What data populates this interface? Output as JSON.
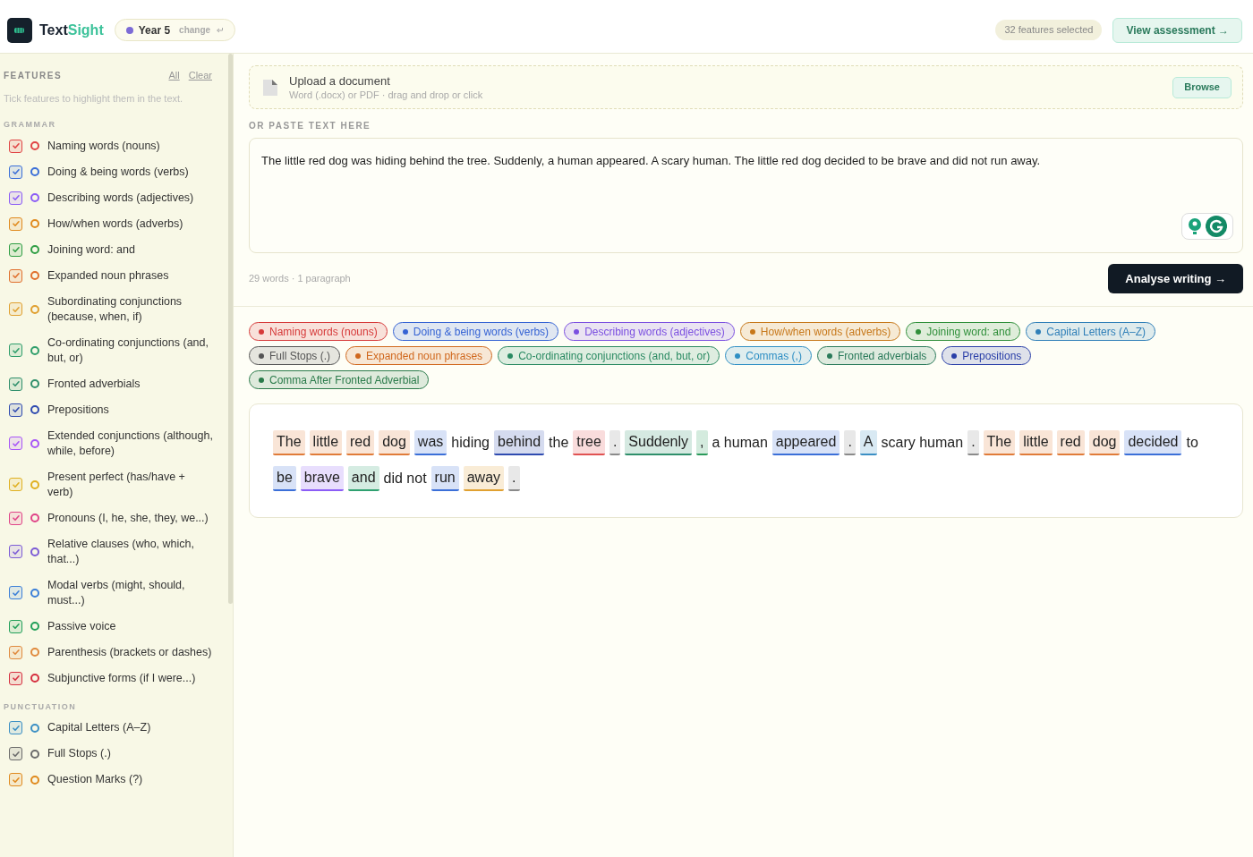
{
  "header": {
    "brand": {
      "first": "Text",
      "second": "Sight"
    },
    "year": {
      "label": "Year 5",
      "action": "change",
      "color": "#7c6bd6"
    },
    "count": "32 features selected",
    "view_button": "View assessment →"
  },
  "sidebar": {
    "title": "FEATURES",
    "all": "All",
    "clear": "Clear",
    "hint": "Tick features to highlight them in the text.",
    "groups": [
      {
        "title": "GRAMMAR",
        "items": [
          {
            "label": "Naming words (nouns)",
            "checked": true,
            "color": "#e04444"
          },
          {
            "label": "Doing & being words (verbs)",
            "checked": true,
            "color": "#3b6fd8"
          },
          {
            "label": "Describing words (adjectives)",
            "checked": true,
            "color": "#8b5cf6"
          },
          {
            "label": "How/when words (adverbs)",
            "checked": true,
            "color": "#e08a1e"
          },
          {
            "label": "Joining word: and",
            "checked": true,
            "color": "#2f9e44"
          },
          {
            "label": "Expanded noun phrases",
            "checked": true,
            "color": "#e0702e"
          },
          {
            "label": "Subordinating conjunctions (because, when, if)",
            "checked": true,
            "color": "#e0a030"
          },
          {
            "label": "Co-ordinating conjunctions (and, but, or)",
            "checked": true,
            "color": "#2f9e6b"
          },
          {
            "label": "Fronted adverbials",
            "checked": true,
            "color": "#2f8f6b"
          },
          {
            "label": "Prepositions",
            "checked": true,
            "color": "#2f4bb0"
          },
          {
            "label": "Extended conjunctions (although, while, before)",
            "checked": true,
            "color": "#a855f7"
          },
          {
            "label": "Present perfect (has/have + verb)",
            "checked": true,
            "color": "#e0b020"
          },
          {
            "label": "Pronouns (I, he, she, they, we...)",
            "checked": true,
            "color": "#e04488"
          },
          {
            "label": "Relative clauses (who, which, that...)",
            "checked": true,
            "color": "#7c5cd6"
          },
          {
            "label": "Modal verbs (might, should, must...)",
            "checked": true,
            "color": "#3b7fd8"
          },
          {
            "label": "Passive voice",
            "checked": true,
            "color": "#22a05a"
          },
          {
            "label": "Parenthesis (brackets or dashes)",
            "checked": true,
            "color": "#e08a3e"
          },
          {
            "label": "Subjunctive forms (if I were...)",
            "checked": true,
            "color": "#d63040"
          }
        ]
      },
      {
        "title": "PUNCTUATION",
        "items": [
          {
            "label": "Capital Letters (A–Z)",
            "checked": true,
            "color": "#3b8fc4"
          },
          {
            "label": "Full Stops (.)",
            "checked": true,
            "color": "#6b6b6b"
          },
          {
            "label": "Question Marks (?)",
            "checked": true,
            "color": "#e08a1e"
          }
        ]
      }
    ]
  },
  "upload": {
    "title": "Upload a document",
    "hint": "Word (.docx) or PDF · drag and drop or click",
    "button": "Browse"
  },
  "paste_label": "OR PASTE TEXT HERE",
  "text_input": {
    "value": "The little red dog was hiding behind the tree. Suddenly, a human appeared. A scary human. The little red dog decided to be brave and did not run away."
  },
  "stats": "29 words · 1 paragraph",
  "analyse_button": "Analyse writing →",
  "chips": [
    {
      "label": "Naming words (nouns)",
      "color": "#d63a3a"
    },
    {
      "label": "Doing & being words (verbs)",
      "color": "#3563d4"
    },
    {
      "label": "Describing words (adjectives)",
      "color": "#7b4fe0"
    },
    {
      "label": "How/when words (adverbs)",
      "color": "#c7781a"
    },
    {
      "label": "Joining word: and",
      "color": "#2f8f3a"
    },
    {
      "label": "Capital Letters (A–Z)",
      "color": "#2f7fb8"
    },
    {
      "label": "Full Stops (.)",
      "color": "#555555"
    },
    {
      "label": "Expanded noun phrases",
      "color": "#d0681e"
    },
    {
      "label": "Co-ordinating conjunctions (and, but, or)",
      "color": "#2a8a62"
    },
    {
      "label": "Commas (,)",
      "color": "#2f8fc4"
    },
    {
      "label": "Fronted adverbials",
      "color": "#2a7a5a"
    },
    {
      "label": "Prepositions",
      "color": "#2a3fa8"
    },
    {
      "label": "Comma After Fronted Adverbial",
      "color": "#2a7a4a"
    }
  ],
  "analysis": [
    {
      "text": "The",
      "color": "#e07b39"
    },
    {
      "text": "little",
      "color": "#e07b39"
    },
    {
      "text": "red",
      "color": "#e07b39"
    },
    {
      "text": "dog",
      "color": "#e07b39"
    },
    {
      "text": "was",
      "color": "#3b6fd8"
    },
    {
      "text": "hiding"
    },
    {
      "text": "behind",
      "color": "#2f4bb0"
    },
    {
      "text": "the"
    },
    {
      "text": "tree",
      "color": "#e05252"
    },
    {
      "text": ".",
      "color": "#8a8a8a"
    },
    {
      "text": "Suddenly",
      "color": "#2f8f6b"
    },
    {
      "text": ",",
      "color": "#2a9a5a"
    },
    {
      "text": "a human"
    },
    {
      "text": "appeared",
      "color": "#3b6fd8"
    },
    {
      "text": ".",
      "color": "#8a8a8a"
    },
    {
      "text": "A",
      "color": "#3b8fc4"
    },
    {
      "text": "scary human"
    },
    {
      "text": ".",
      "color": "#8a8a8a"
    },
    {
      "text": "The",
      "color": "#e07b39"
    },
    {
      "text": "little",
      "color": "#e07b39"
    },
    {
      "text": "red",
      "color": "#e07b39"
    },
    {
      "text": "dog",
      "color": "#e07b39"
    },
    {
      "text": "decided",
      "color": "#3b6fd8"
    },
    {
      "text": "to"
    },
    {
      "text": "be",
      "color": "#3b6fd8"
    },
    {
      "text": "brave",
      "color": "#8b5cf6"
    },
    {
      "text": "and",
      "color": "#2fa070"
    },
    {
      "text": "did not"
    },
    {
      "text": "run",
      "color": "#3b6fd8"
    },
    {
      "text": "away",
      "color": "#e0a030"
    },
    {
      "text": ".",
      "color": "#8a8a8a"
    }
  ]
}
